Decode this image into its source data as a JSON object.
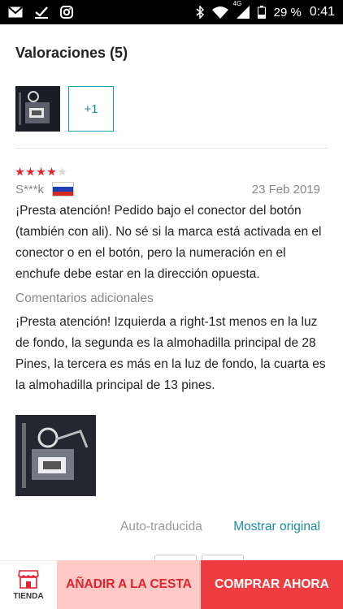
{
  "status_bar": {
    "network": "4G",
    "battery": "29 %",
    "time": "0:41",
    "icons": [
      "gmail-icon",
      "check-icon",
      "instagram-icon",
      "bluetooth-icon",
      "wifi-icon",
      "signal-icon",
      "battery-icon"
    ]
  },
  "reviews": {
    "title": "Valoraciones (5)",
    "more_photos": "+1"
  },
  "review": {
    "rating": 4,
    "max_rating": 5,
    "user": "S***k",
    "country_flag": "russia-flag",
    "date": "23 Feb 2019",
    "text": "¡Presta atención! Pedido bajo el conector del botón (también con ali). No sé si la marca está activada en el conector o en el botón, pero la numeración en el enchufe debe estar en la dirección opuesta.",
    "additional_label": "Comentarios adicionales",
    "additional_text": "¡Presta atención! Izquierda a right-1st menos en la luz de fondo, la segunda es la almohadilla principal de 28 Pines, la tercera es más en la luz de fondo, la cuarta es la almohadilla principal de 13 pines."
  },
  "translation": {
    "auto_label": "Auto-traducida",
    "show_original": "Mostrar original"
  },
  "bottom_bar": {
    "store_label": "TIENDA",
    "add_to_cart": "AÑADIR A LA CESTA",
    "buy_now": "COMPRAR AHORA"
  },
  "colors": {
    "accent_teal": "#1a8ea0",
    "star_red": "#e2232e",
    "buy_red": "#ef3d3f",
    "cart_pink": "#ffc9c5"
  }
}
